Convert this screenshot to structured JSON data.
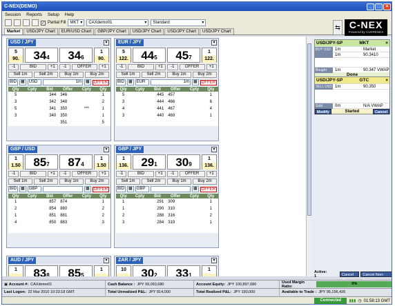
{
  "window": {
    "title": "C-NEX(DEMO)"
  },
  "menu": [
    "Session",
    "Reports",
    "Setup",
    "Help"
  ],
  "toolbar": {
    "partial_fill_label": "Partial Fill",
    "order_type": "MKT",
    "account": "CAXdemo01",
    "view": "Standard"
  },
  "logo": {
    "brand": "C-NEX",
    "tagline": "Powered by CURRENEX"
  },
  "tabs": [
    "Market",
    "USD/JPY Chart",
    "EUR/USD Chart",
    "GBP/JPY Chart",
    "USD/JPY Chart",
    "USD/JPY Chart",
    "USD/JPY Chart"
  ],
  "panels": [
    {
      "pair": "USD / JPY",
      "bid_size": "5",
      "bid_big": "90.",
      "bid_main": "34",
      "bid_pip": "4",
      "ask_main": "34",
      "ask_pip": "6",
      "ask_size": "1",
      "ask_big": "90.",
      "ccy": "USD",
      "qty": "1m",
      "offer_label": "OFFER",
      "rows": [
        [
          "5",
          "344",
          "346",
          "1"
        ],
        [
          "3",
          "342",
          "348",
          "2"
        ],
        [
          "5",
          "341",
          "350",
          "1"
        ],
        [
          "3",
          "340",
          "350",
          "1"
        ],
        [
          "",
          "",
          "351",
          "5"
        ]
      ],
      "mark": "***"
    },
    {
      "pair": "EUR / JPY",
      "bid_size": "5",
      "bid_big": "122.",
      "bid_main": "44",
      "bid_pip": "5",
      "ask_main": "45",
      "ask_pip": "7",
      "ask_size": "1",
      "ask_big": "122.",
      "ccy": "EUR",
      "qty": "1m",
      "offer_label": "OFFER",
      "rows": [
        [
          "5",
          "445",
          "457",
          "1"
        ],
        [
          "3",
          "444",
          "466",
          "6"
        ],
        [
          "4",
          "441",
          "467",
          "4"
        ],
        [
          "3",
          "440",
          "469",
          "1"
        ]
      ],
      "mark": ""
    },
    {
      "pair": "GBP / USD",
      "bid_size": "1",
      "bid_big": "1.50",
      "bid_main": "85",
      "bid_pip": "7",
      "ask_main": "87",
      "ask_pip": "4",
      "ask_size": "1",
      "ask_big": "1.50",
      "ccy": "GBP",
      "qty": "",
      "offer_label": "OFFER",
      "rows": [
        [
          "1",
          "857",
          "874",
          "1"
        ],
        [
          "2",
          "854",
          "880",
          "2"
        ],
        [
          "1",
          "851",
          "881",
          "2"
        ],
        [
          "4",
          "850",
          "883",
          "3"
        ]
      ],
      "mark": ""
    },
    {
      "pair": "GBP / JPY",
      "bid_size": "1",
      "bid_big": "136.",
      "bid_main": "29",
      "bid_pip": "1",
      "ask_main": "30",
      "ask_pip": "9",
      "ask_size": "1",
      "ask_big": "136.",
      "ccy": "GBP",
      "qty": "",
      "offer_label": "OFFER",
      "rows": [
        [
          "1",
          "291",
          "309",
          "1"
        ],
        [
          "1",
          "290",
          "310",
          "1"
        ],
        [
          "2",
          "288",
          "316",
          "2"
        ],
        [
          "3",
          "284",
          "319",
          "1"
        ]
      ],
      "mark": ""
    },
    {
      "pair": "AUD / JPY",
      "bid_size": "1",
      "bid_big": "",
      "bid_main": "83",
      "bid_pip": "8",
      "ask_main": "85",
      "ask_pip": "5",
      "ask_size": "1",
      "ask_big": ""
    },
    {
      "pair": "ZAR / JPY",
      "bid_size": "10",
      "bid_big": "",
      "bid_main": "30",
      "bid_pip": "2",
      "ask_main": "33",
      "ask_pip": "1",
      "ask_size": "1",
      "ask_big": ""
    }
  ],
  "buttons": {
    "m1": "-1",
    "bid": "BID",
    "p1": "+1",
    "offer": "OFFER",
    "sell1": "Sell 1m",
    "sell2": "Sell 2m",
    "buy1": "Buy 1m",
    "buy2": "Buy 2m",
    "bid_short": "BID"
  },
  "book_headers": [
    "Qty",
    "Cpty",
    "Bid",
    "Offer",
    "Cpty",
    "Qty"
  ],
  "orders": [
    {
      "title": "USD/JPY-SP",
      "type": "MKT",
      "side": "BUY USD",
      "amt": "1m",
      "price_label": "Market",
      "qty2": "1m",
      "price2": "90.3410",
      "side2": "Bought",
      "amt2": "1m",
      "vwap": "90.347 VWAP",
      "status": "Done"
    },
    {
      "title": "USD/JPY-SP",
      "type": "GTC",
      "side": "SELL USD",
      "amt": "1m",
      "price": "90.350",
      "side2": "Sold",
      "amt2": "0m",
      "vwap": "N/A VWAP",
      "modify": "Modify",
      "status": "Started",
      "cancel": "Cancel"
    }
  ],
  "active": {
    "label": "Active: 1",
    "cancel_all": "Cancel All",
    "cancel_non_stops": "Cancel Non-Stops"
  },
  "footer": {
    "account_label": "Account #:",
    "account": "CAXdemo01",
    "last_logon_label": "Last Logon:",
    "last_logon": "22 Mar 2010 10:33:18 GMT",
    "cash_label": "Cash Balance :",
    "cash": "JPY 99,093,680",
    "unreal_label": "Total Unrealized P&L:",
    "unreal": "JPY 814,000",
    "equity_label": "Account Equity:",
    "equity": "JPY 100,897,680",
    "real_label": "Total Realized P&L:",
    "real": "JPY 190,000",
    "used_margin_label": "Used Margin Ratio:",
    "used_margin": "0%",
    "avail_label": "Available to Trade :",
    "avail": "JPY 95,156,426"
  },
  "status": {
    "connection": "Connected",
    "time": "01:58:13 GMT"
  }
}
